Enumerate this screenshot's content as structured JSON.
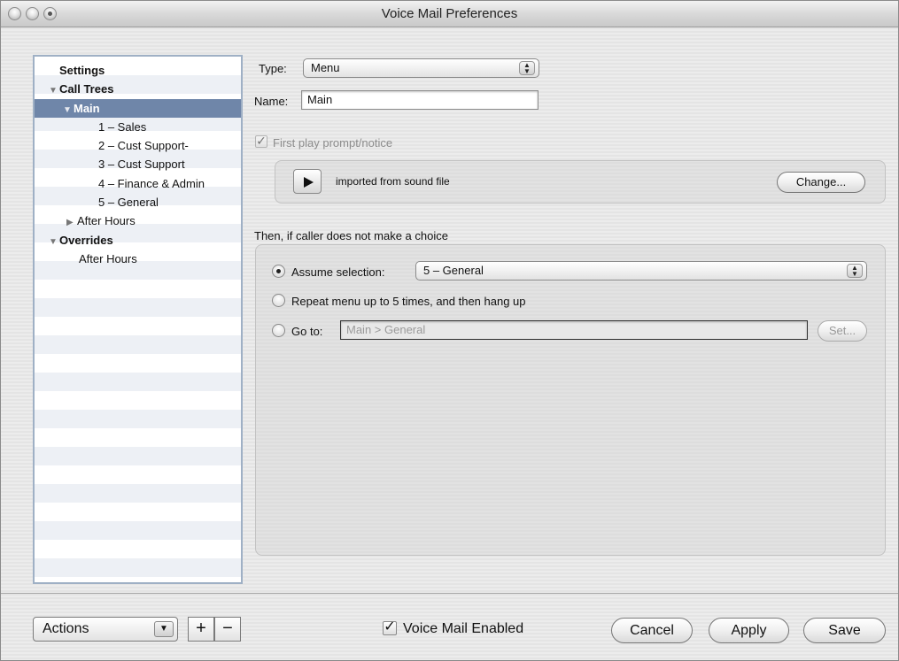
{
  "window": {
    "title": "Voice Mail Preferences"
  },
  "sidebar": {
    "items": [
      {
        "label": "Settings",
        "bold": true
      },
      {
        "label": "Call Trees",
        "bold": true,
        "disclosure": "expanded"
      },
      {
        "label": "Main",
        "bold": true,
        "disclosure": "expanded",
        "selected": true
      },
      {
        "label": "1 – Sales"
      },
      {
        "label": "2 – Cust Support-"
      },
      {
        "label": "3 – Cust Support"
      },
      {
        "label": "4 – Finance & Admin"
      },
      {
        "label": "5 – General"
      },
      {
        "label": "After Hours",
        "disclosure": "collapsed"
      },
      {
        "label": "Overrides",
        "bold": true,
        "disclosure": "expanded"
      },
      {
        "label": "After Hours"
      }
    ]
  },
  "form": {
    "type_label": "Type:",
    "type_value": "Menu",
    "name_label": "Name:",
    "name_value": "Main",
    "first_play_label": "First play prompt/notice",
    "first_play_checked": true,
    "prompt_text": "imported from sound file",
    "change_button": "Change...",
    "then_label": "Then, if caller does not make a choice",
    "assume_label": "Assume selection:",
    "assume_value": "5 – General",
    "repeat_label": "Repeat menu up to 5 times, and then hang up",
    "goto_label": "Go to:",
    "goto_value": "Main > General",
    "set_button": "Set...",
    "selected_option": "assume"
  },
  "footer": {
    "actions_label": "Actions",
    "add_label": "+",
    "remove_label": "−",
    "vm_enabled_label": "Voice Mail Enabled",
    "vm_enabled_checked": true,
    "cancel_label": "Cancel",
    "apply_label": "Apply",
    "save_label": "Save"
  }
}
